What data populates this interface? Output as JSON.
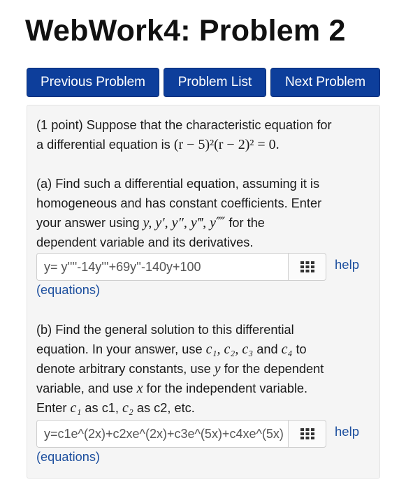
{
  "page": {
    "title": "WebWork4: Problem 2"
  },
  "nav": {
    "previous": "Previous Problem",
    "list": "Problem List",
    "next": "Next Problem"
  },
  "problem": {
    "intro_1": "(1 point) Suppose that the characteristic equation for",
    "intro_2_prefix": "a differential equation is ",
    "char_eq": "(r − 5)²(r − 2)² = 0.",
    "a_line1": "(a) Find such a differential equation, assuming it is",
    "a_line2": "homogeneous and has constant coefficients. Enter",
    "a_line3_prefix": "your answer using ",
    "a_vars": "y, y′, y″, y‴, y⁗",
    "a_line3_suffix": " for the",
    "a_line4": "dependent variable and its derivatives.",
    "a_answer": "y= y''''-14y'''+69y''-140y+100",
    "b_line1": "(b) Find the general solution to this differential",
    "b_line2_prefix": "equation. In your answer, use ",
    "b_vars": "c₁, c₂, c₃",
    "b_and": " and ",
    "b_c4": "c₄",
    "b_line2_suffix": " to",
    "b_line3_prefix": "denote arbitrary constants, use ",
    "b_y": "y",
    "b_line3_suffix": " for the dependent",
    "b_line4_prefix": "variable, and use ",
    "b_x": "x",
    "b_line4_suffix": " for the independent variable.",
    "b_line5_prefix": "Enter ",
    "b_c1": "c₁",
    "b_as_c1": " as c1, ",
    "b_c2": "c₂",
    "b_as_c2": " as c2, etc.",
    "b_answer": "y=c1e^(2x)+c2xe^(2x)+c3e^(5x)+c4xe^(5x)"
  },
  "links": {
    "help": "help",
    "equations": "(equations)"
  },
  "colors": {
    "nav_button": "#0d3e9b",
    "link": "#1d4f9e",
    "panel_bg": "#f5f5f5"
  },
  "icons": {
    "keypad": "keypad-icon"
  }
}
